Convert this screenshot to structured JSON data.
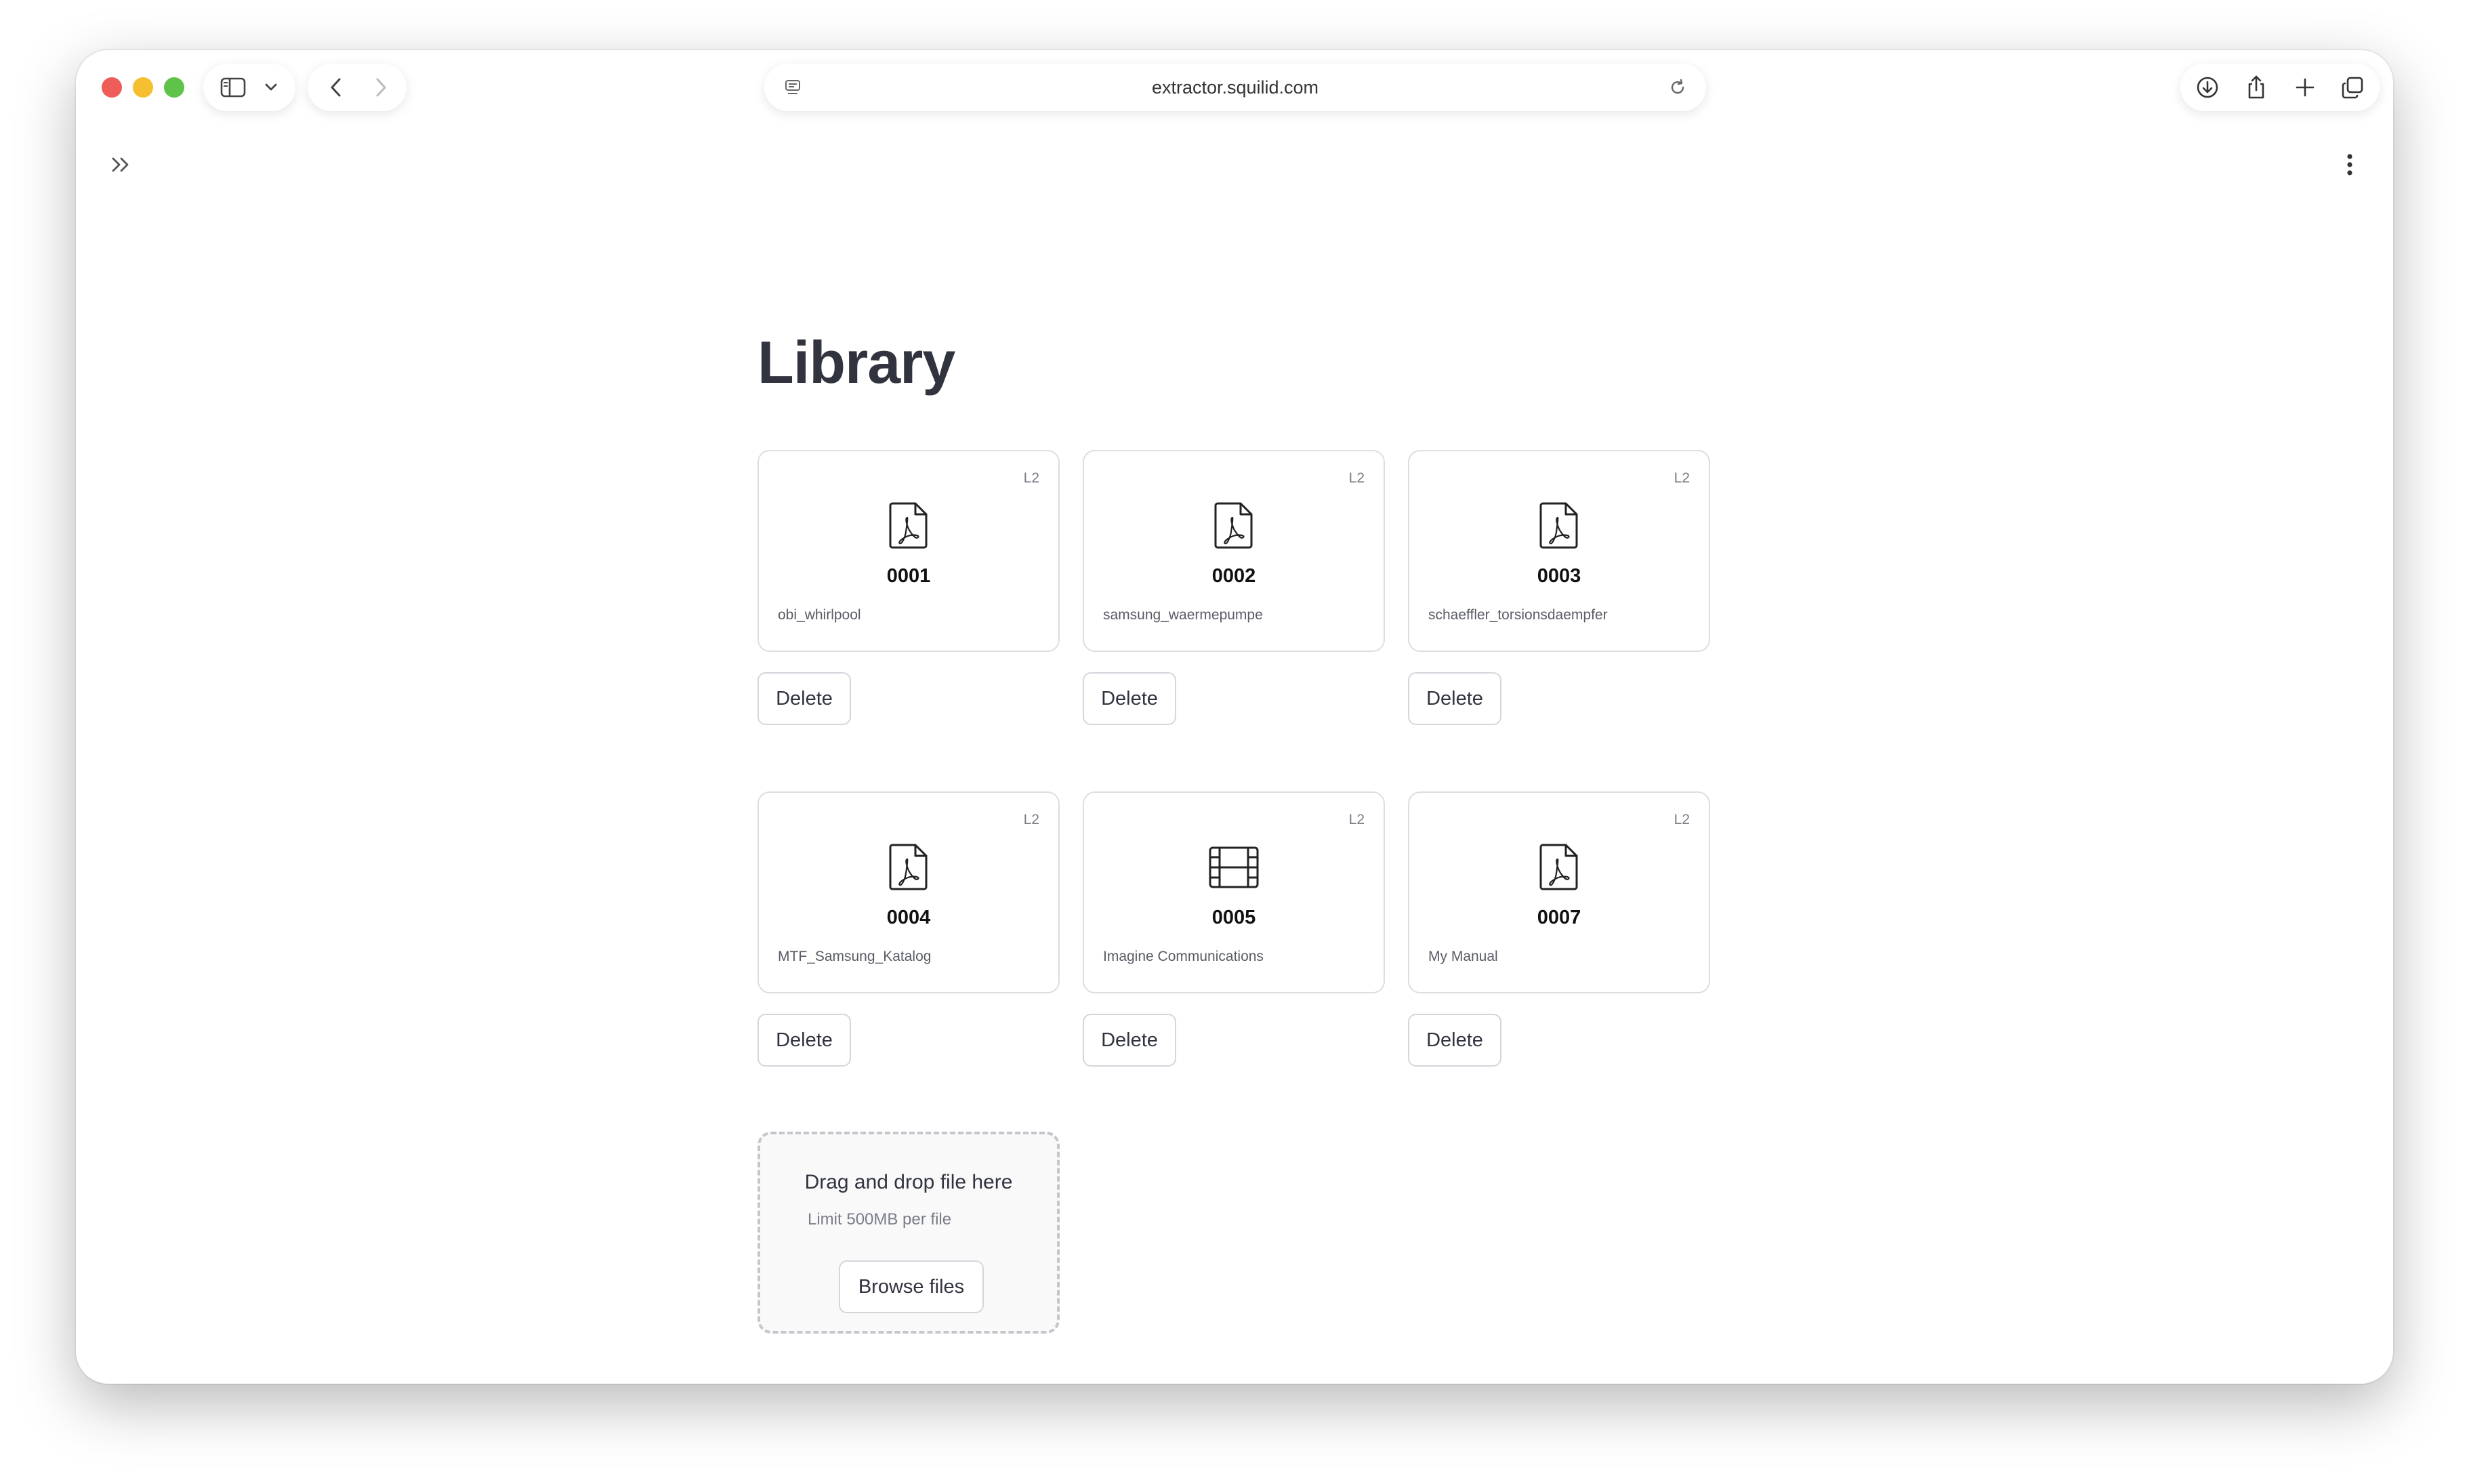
{
  "browser": {
    "url": "extractor.squilid.com"
  },
  "page": {
    "title": "Library"
  },
  "cards": [
    {
      "id": "0001",
      "name": "obi_whirlpool",
      "level": "L2",
      "icon": "pdf-icon"
    },
    {
      "id": "0002",
      "name": "samsung_waermepumpe",
      "level": "L2",
      "icon": "pdf-icon"
    },
    {
      "id": "0003",
      "name": "schaeffler_torsionsdaempfer",
      "level": "L2",
      "icon": "pdf-icon"
    },
    {
      "id": "0004",
      "name": "MTF_Samsung_Katalog",
      "level": "L2",
      "icon": "pdf-icon"
    },
    {
      "id": "0005",
      "name": "Imagine Communications",
      "level": "L2",
      "icon": "film-icon"
    },
    {
      "id": "0007",
      "name": "My Manual",
      "level": "L2",
      "icon": "pdf-icon"
    }
  ],
  "actions": {
    "delete_label": "Delete"
  },
  "uploader": {
    "title": "Drag and drop file here",
    "limit": "Limit 500MB per file",
    "browse_label": "Browse files"
  },
  "colors": {
    "text_primary": "#31333f",
    "card_border": "#dddde2",
    "traffic_red": "#ee5d57",
    "traffic_yellow": "#f5bf2f",
    "traffic_green": "#5fc249"
  }
}
